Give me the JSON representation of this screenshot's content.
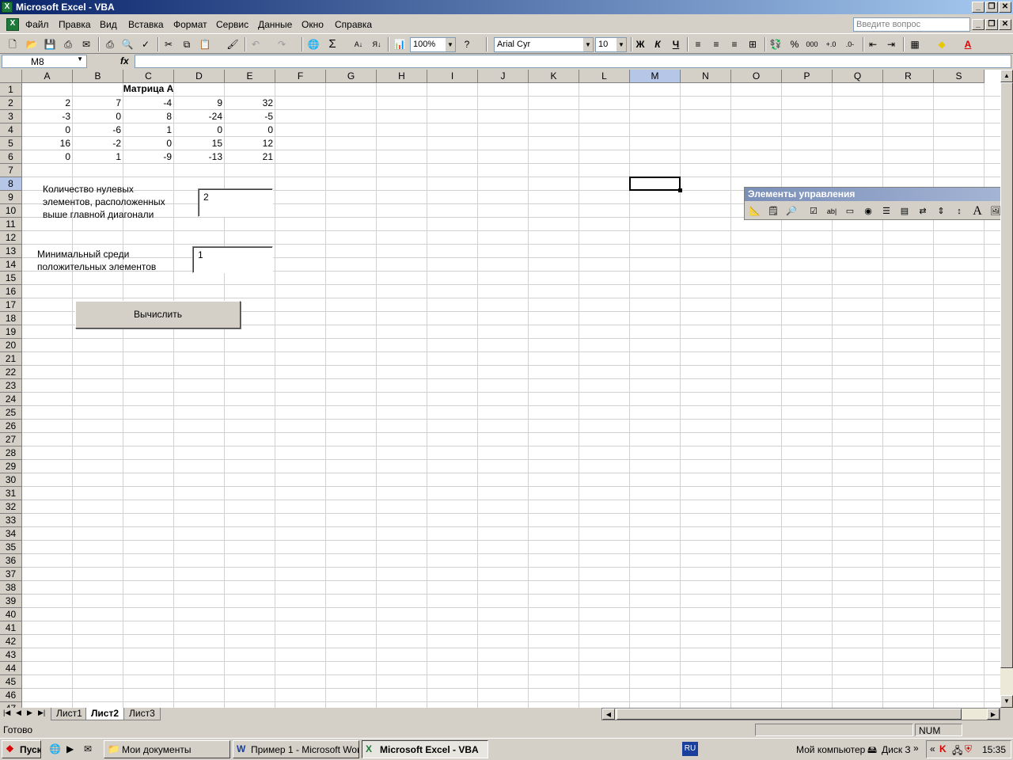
{
  "window": {
    "title": "Microsoft Excel - VBA"
  },
  "menu": [
    "Файл",
    "Правка",
    "Вид",
    "Вставка",
    "Формат",
    "Сервис",
    "Данные",
    "Окно",
    "Справка"
  ],
  "ask_placeholder": "Введите вопрос",
  "toolbar": {
    "zoom": "100%",
    "font": "Arial Cyr",
    "size": "10",
    "bold": "Ж",
    "italic": "К",
    "underline": "Ч",
    "percent": "%",
    "thousands": "000"
  },
  "namebox": "M8",
  "fx": "fx",
  "columns": [
    "A",
    "B",
    "C",
    "D",
    "E",
    "F",
    "G",
    "H",
    "I",
    "J",
    "K",
    "L",
    "M",
    "N",
    "O",
    "P",
    "Q",
    "R",
    "S"
  ],
  "selected_column": "M",
  "selected_row": "8",
  "matrix_title": "Матрица А",
  "matrix": [
    [
      2,
      7,
      -4,
      9,
      32
    ],
    [
      -3,
      0,
      8,
      -24,
      -5
    ],
    [
      0,
      -6,
      1,
      0,
      0
    ],
    [
      16,
      -2,
      0,
      15,
      12
    ],
    [
      0,
      1,
      -9,
      -13,
      21
    ]
  ],
  "label_zero": [
    "Количество нулевых",
    "элементов, расположенных",
    "выше главной диагонали"
  ],
  "result_zero": "2",
  "label_min": [
    "Минимальный среди",
    "положительных элементов"
  ],
  "result_min": "1",
  "calc_button": "Вычислить",
  "control_panel_title": "Элементы управления",
  "sheets": [
    "Лист1",
    "Лист2",
    "Лист3"
  ],
  "active_sheet": "Лист2",
  "status": {
    "left": "Готово",
    "num": "NUM"
  },
  "taskbar": {
    "start": "Пуск",
    "tasks": [
      "Мои документы",
      "Пример 1 - Microsoft Word",
      "Microsoft Excel - VBA"
    ],
    "lang": "RU",
    "tray_text": "Мой компьютер",
    "disk": "Диск З",
    "clock": "15:35"
  }
}
